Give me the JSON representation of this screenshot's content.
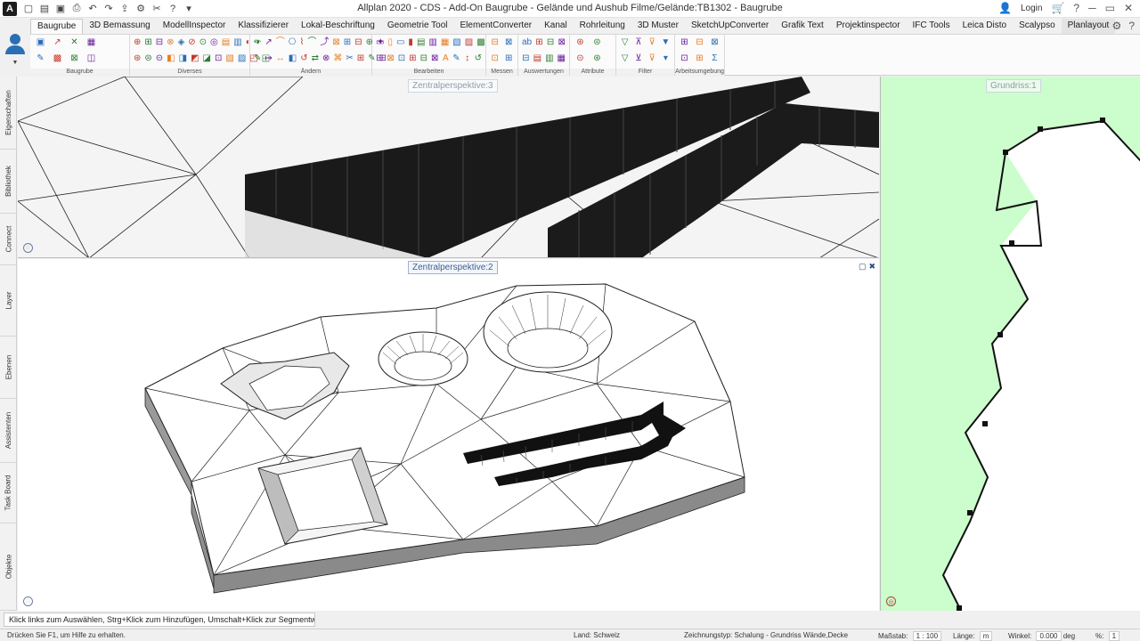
{
  "window": {
    "app_logo": "A",
    "title": "Allplan 2020 - CDS - Add-On Baugrube - Gelände und Aushub Filme/Gelände:TB1302 - Baugrube",
    "login": "Login",
    "qat_icons": [
      "new-icon",
      "open-icon",
      "save-icon",
      "print-icon",
      "undo-icon",
      "redo-icon",
      "share-icon",
      "settings-icon",
      "tools-icon",
      "help-icon",
      "dropdown-icon"
    ]
  },
  "tabs": [
    {
      "label": "Baugrube",
      "active": true
    },
    {
      "label": "3D Bemassung"
    },
    {
      "label": "ModellInspector"
    },
    {
      "label": "Klassifizierer"
    },
    {
      "label": "Lokal-Beschriftung"
    },
    {
      "label": "Geometrie Tool"
    },
    {
      "label": "ElementConverter"
    },
    {
      "label": "Kanal"
    },
    {
      "label": "Rohrleitung"
    },
    {
      "label": "3D Muster"
    },
    {
      "label": "SketchUpConverter"
    },
    {
      "label": "Grafik Text"
    },
    {
      "label": "Projektinspector"
    },
    {
      "label": "IFC Tools"
    },
    {
      "label": "Leica Disto"
    },
    {
      "label": "Scalypso"
    },
    {
      "label": "Planlayout",
      "highlight": true
    }
  ],
  "ribbon_groups": [
    {
      "label": "Baugrube",
      "r1": [
        "▣",
        "↗",
        "✕",
        "▦"
      ],
      "r2": [
        "✎",
        "▩",
        "⊠",
        "◫"
      ]
    },
    {
      "label": "Diverses",
      "r1": [
        "⊕",
        "⊞",
        "⊟",
        "⊗",
        "◈",
        "⊘",
        "⊙",
        "◎",
        "▤",
        "▥",
        "◐",
        "◑"
      ],
      "r2": [
        "⊛",
        "⊜",
        "⊝",
        "◧",
        "◨",
        "◩",
        "◪",
        "⊡",
        "▧",
        "▨",
        "◰",
        "◱"
      ]
    },
    {
      "label": "Ändern",
      "r1": [
        "✏",
        "↗",
        "⌒",
        "⎔",
        "⌇",
        "⌒",
        "⤴",
        "⊠",
        "⊞",
        "⊟",
        "⊕",
        "✦"
      ],
      "r2": [
        "✎",
        "↦",
        "↔",
        "◧",
        "↺",
        "⇄",
        "⊗",
        "⌘",
        "✂",
        "⊞",
        "✎",
        "⊟"
      ]
    },
    {
      "label": "Bearbeiten",
      "r1": [
        "▭",
        "▯",
        "▭",
        "▮",
        "▤",
        "▥",
        "▦",
        "▧",
        "▨",
        "▩"
      ],
      "r2": [
        "⊟",
        "⊠",
        "⊡",
        "⊞",
        "⊟",
        "⊠",
        "A",
        "✎",
        "↕",
        "↺"
      ]
    },
    {
      "label": "Messen",
      "r1": [
        "⊟",
        "⊠"
      ],
      "r2": [
        "⊡",
        "⊞"
      ]
    },
    {
      "label": "Auswertungen",
      "r1": [
        "ab",
        "⊞",
        "⊟",
        "⊠"
      ],
      "r2": [
        "⊟",
        "▤",
        "▥",
        "▦"
      ]
    },
    {
      "label": "Attribute",
      "r1": [
        "⊛",
        "⊜"
      ],
      "r2": [
        "⊝",
        "⊛"
      ]
    },
    {
      "label": "Filter",
      "r1": [
        "▽",
        "⊼",
        "⊽",
        "▼"
      ],
      "r2": [
        "▽",
        "⊻",
        "⊽",
        "▾"
      ]
    },
    {
      "label": "Arbeitsumgebung",
      "r1": [
        "⊞",
        "⊟",
        "⊠"
      ],
      "r2": [
        "⊡",
        "⊞",
        "Σ"
      ]
    }
  ],
  "sidebar": [
    "Eigenschaften",
    "Bibliothek",
    "Connect",
    "Layer",
    "Ebenen",
    "Assistenten",
    "Task Board",
    "Objekte"
  ],
  "viewports": {
    "top_label": "Zentralperspektive:3",
    "main_label": "Zentralperspektive:2",
    "plan_label": "Grundriss:1"
  },
  "prompt": "Klick links zum Auswählen, Strg+Klick zum Hinzufügen, Umschalt+Klick zur Segmentwahl",
  "status": {
    "help": "Drücken Sie F1, um Hilfe zu erhalten.",
    "land_label": "Land:",
    "land_value": "Schweiz",
    "zeichnungstyp_label": "Zeichnungstyp:",
    "zeichnungstyp_value": "Schalung - Grundriss Wände,Decke",
    "massstab_label": "Maßstab:",
    "massstab_value": "1 : 100",
    "laenge_label": "Länge:",
    "laenge_value": "m",
    "winkel_label": "Winkel:",
    "winkel_value": "0.000",
    "winkel_unit": "deg",
    "percent_label": "%:",
    "percent_value": "1"
  },
  "colors": {
    "plan_background": "#ccfdcc",
    "accent": "#2a6fb5"
  }
}
